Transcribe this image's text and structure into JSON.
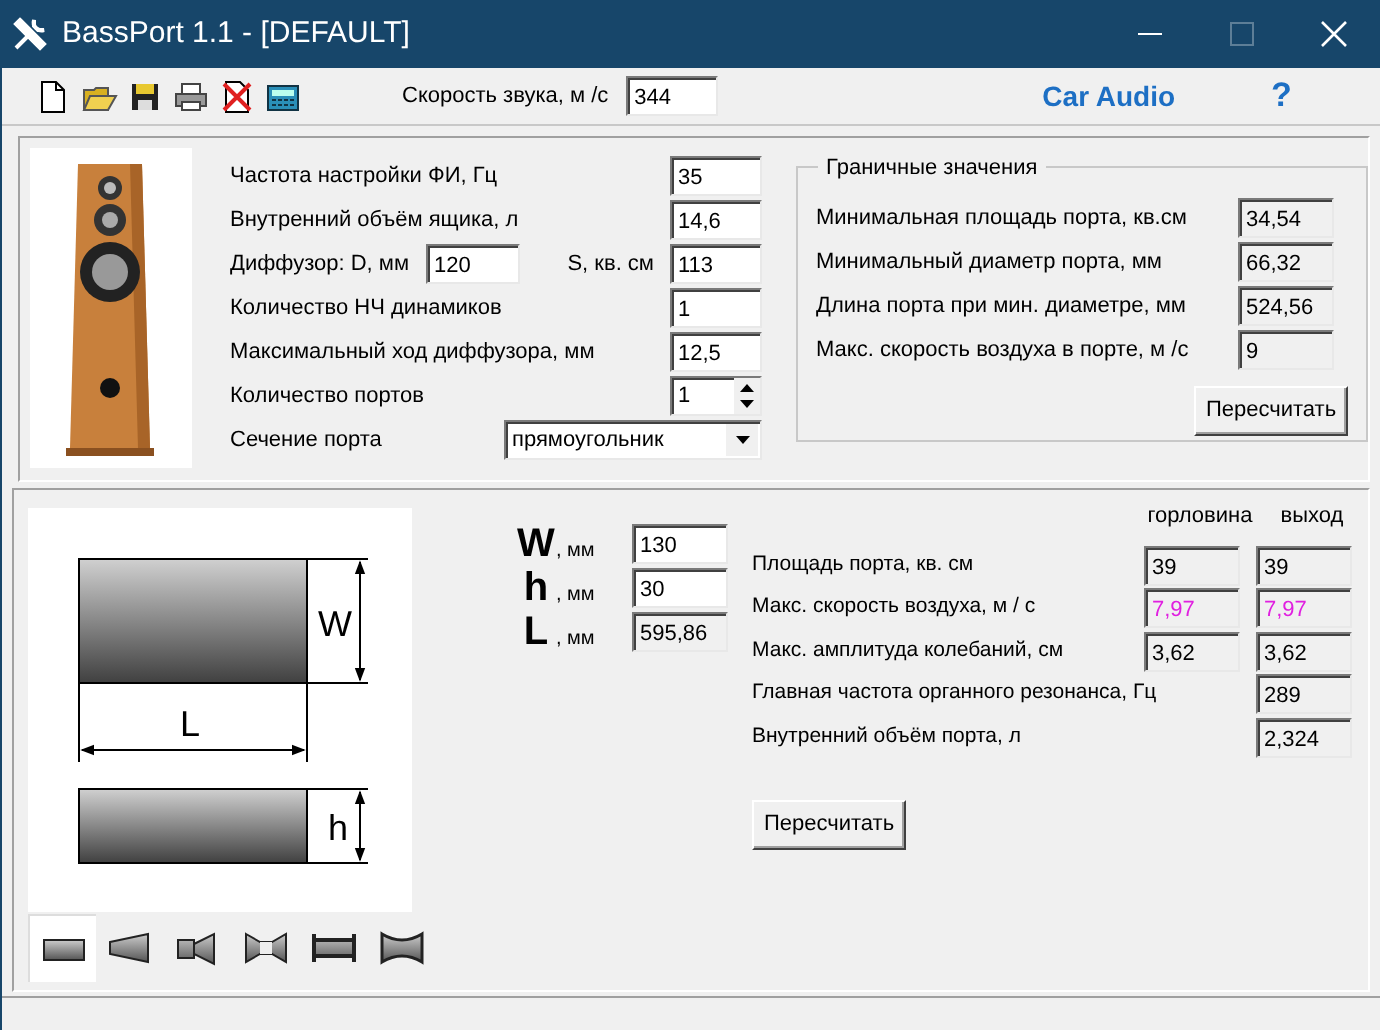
{
  "window": {
    "title": "BassPort 1.1 - [DEFAULT]",
    "controls": [
      {
        "kind": "minimize",
        "disabled": false
      },
      {
        "kind": "maximize",
        "disabled": true
      },
      {
        "kind": "close",
        "disabled": false
      }
    ]
  },
  "toolbar": {
    "tools": [
      {
        "kind": "new"
      },
      {
        "kind": "open"
      },
      {
        "kind": "save"
      },
      {
        "kind": "print"
      },
      {
        "kind": "delete"
      },
      {
        "kind": "calculator"
      }
    ],
    "sound_speed": {
      "label": "Скорость звука, м /с",
      "value": "344"
    },
    "link": "Car Audio",
    "help": "?"
  },
  "inputs": [
    {
      "kind": "field",
      "label": "Частота настройки ФИ, Гц",
      "value": "35"
    },
    {
      "kind": "field",
      "label": "Внутренний объём ящика, л",
      "value": "14,6"
    },
    {
      "kind": "pair",
      "label": "Диффузор: D, мм",
      "value": "120",
      "label2": "S, кв. см",
      "value2": "113"
    },
    {
      "kind": "field",
      "label": "Количество НЧ динамиков",
      "value": "1"
    },
    {
      "kind": "field",
      "label": "Максимальный ход диффузора, мм",
      "value": "12,5"
    },
    {
      "kind": "spinner",
      "label": "Количество портов",
      "value": "1"
    },
    {
      "kind": "select",
      "label": "Сечение порта",
      "value": "прямоугольник"
    }
  ],
  "limits": {
    "title": "Граничные значения",
    "rows": [
      {
        "label": "Минимальная площадь порта, кв.см",
        "value": "34,54"
      },
      {
        "label": "Минимальный диаметр порта, мм",
        "value": "66,32"
      },
      {
        "label": "Длина порта при мин. диаметре, мм",
        "value": "524,56"
      },
      {
        "label": "Макс. скорость воздуха в порте, м /с",
        "value": "9"
      }
    ],
    "button": "Пересчитать"
  },
  "diagram": {
    "labels": [
      "W",
      "L",
      "h"
    ]
  },
  "shapes": [
    {
      "kind": "straight",
      "selected": true
    },
    {
      "kind": "cone",
      "selected": false
    },
    {
      "kind": "stepped",
      "selected": false
    },
    {
      "kind": "double",
      "selected": false
    },
    {
      "kind": "flared",
      "selected": false
    },
    {
      "kind": "curved",
      "selected": false
    }
  ],
  "dims": [
    {
      "letter": "W",
      "unit": ", мм",
      "value": "130",
      "readonly": false
    },
    {
      "letter": "h",
      "unit": ", мм",
      "value": "30",
      "readonly": false
    },
    {
      "letter": "L",
      "unit": ", мм",
      "value": "595,86",
      "readonly": true
    }
  ],
  "results": {
    "columns": [
      "горловина",
      "выход"
    ],
    "rows": [
      {
        "label": "Площадь порта, кв. см",
        "throat": "39",
        "outlet": "39",
        "warning": false
      },
      {
        "label": "Макс. скорость воздуха, м / с",
        "throat": "7,97",
        "outlet": "7,97",
        "warning": true
      },
      {
        "label": "Макс. амплитуда колебаний, см",
        "throat": "3,62",
        "outlet": "3,62",
        "warning": false
      },
      {
        "label": "Главная частота органного резонанса, Гц",
        "outlet": "289",
        "warning": false
      },
      {
        "label": "Внутренний объём порта, л",
        "outlet": "2,324",
        "warning": false
      }
    ],
    "button": "Пересчитать"
  }
}
